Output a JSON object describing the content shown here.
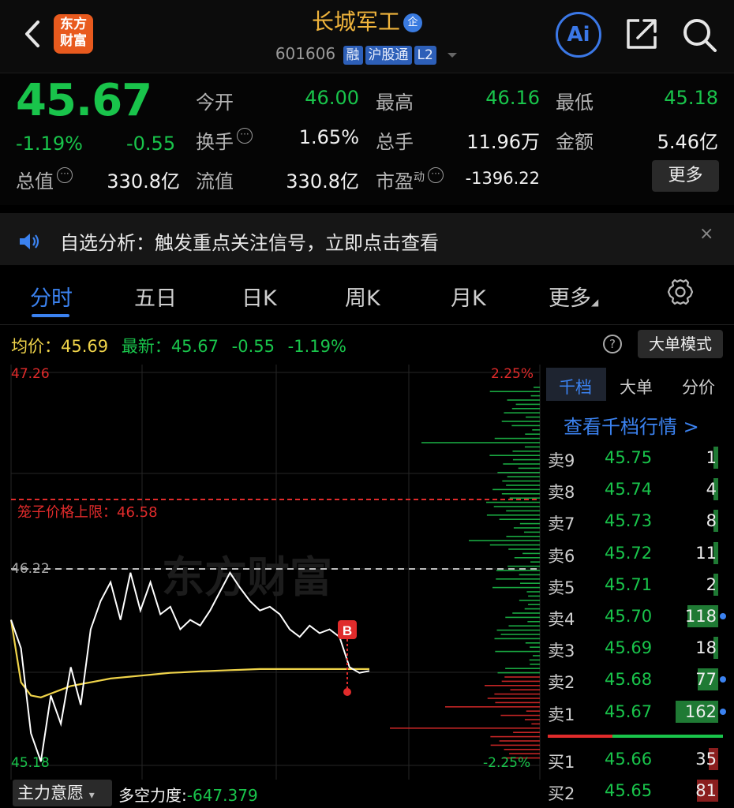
{
  "header": {
    "logo_line1": "东方",
    "logo_line2": "财富",
    "stock_name": "长城军工",
    "name_badge": "企",
    "code": "601606",
    "tags": [
      "融",
      "沪股通",
      "L2"
    ],
    "ai_label": "Ai"
  },
  "quote": {
    "price": "45.67",
    "change_pct": "-1.19%",
    "change": "-0.55",
    "open_label": "今开",
    "open": "46.00",
    "high_label": "最高",
    "high": "46.16",
    "low_label": "最低",
    "low": "45.18",
    "turnover_label": "换手",
    "turnover": "1.65%",
    "volume_label": "总手",
    "volume": "11.96万",
    "amount_label": "金额",
    "amount": "5.46亿",
    "mktcap_label": "总值",
    "mktcap": "330.8亿",
    "float_label": "流值",
    "float": "330.8亿",
    "pe_label": "市盈",
    "pe_sup": "动",
    "pe": "-1396.22",
    "more_label": "更多",
    "info_glyph": "···"
  },
  "notice": {
    "text": "自选分析：触发重点关注信号，立即点击查看",
    "close": "×"
  },
  "tabs": {
    "items": [
      "分时",
      "五日",
      "日K",
      "周K",
      "月K",
      "更多"
    ],
    "active": "分时",
    "more_caret": "◢"
  },
  "info_row": {
    "avg_label": "均价：",
    "avg": "45.69",
    "latest_label": "最新：",
    "latest": "45.67",
    "change": "-0.55",
    "change_pct": "-1.19%",
    "help": "?",
    "big_order_mode": "大单模式"
  },
  "chart": {
    "top_price": "47.26",
    "bottom_price": "45.18",
    "top_pct": "2.25%",
    "bottom_pct": "-2.25%",
    "limit_label": "笼子价格上限：46.58",
    "prev_close": "46.22",
    "watermark": "东方财富",
    "buy_marker": "B"
  },
  "chart_data": {
    "type": "line",
    "title": "",
    "ylim": [
      45.18,
      47.26
    ],
    "series": [
      {
        "name": "",
        "values": [
          45.95,
          45.8,
          45.35,
          45.2,
          45.55,
          45.4,
          45.7,
          45.5,
          45.9,
          46.05,
          46.15,
          45.95,
          46.2,
          46.0,
          46.15,
          45.98,
          46.02,
          45.9,
          45.95,
          45.92,
          46.0,
          46.1,
          46.2,
          46.12,
          46.05,
          46.0,
          46.02,
          45.98,
          45.9,
          45.86,
          45.92,
          45.88,
          45.9,
          45.86,
          45.7,
          45.67,
          45.68
        ]
      },
      {
        "name": "",
        "values": [
          45.95,
          45.62,
          45.55,
          45.54,
          45.56,
          45.58,
          45.6,
          45.61,
          45.62,
          45.63,
          45.64,
          45.645,
          45.65,
          45.655,
          45.66,
          45.665,
          45.67,
          45.672,
          45.675,
          45.678,
          45.68,
          45.682,
          45.684,
          45.686,
          45.688,
          45.69,
          45.69,
          45.69,
          45.69,
          45.69,
          45.69,
          45.69,
          45.69,
          45.69,
          45.69,
          45.69,
          45.69
        ]
      }
    ],
    "grid": true
  },
  "colors": {
    "up": "#e02b2b",
    "down": "#19c44b",
    "price_line": "#ffffff",
    "avg_line": "#f0d44a",
    "accent": "#3b82f0"
  },
  "order_book": {
    "tabs": [
      "千档",
      "大单",
      "分价"
    ],
    "active_tab": "千档",
    "link": "查看千档行情 >",
    "asks": [
      {
        "label": "卖9",
        "price": "45.75",
        "vol": "1"
      },
      {
        "label": "卖8",
        "price": "45.74",
        "vol": "4"
      },
      {
        "label": "卖7",
        "price": "45.73",
        "vol": "8"
      },
      {
        "label": "卖6",
        "price": "45.72",
        "vol": "11"
      },
      {
        "label": "卖5",
        "price": "45.71",
        "vol": "2"
      },
      {
        "label": "卖4",
        "price": "45.70",
        "vol": "118"
      },
      {
        "label": "卖3",
        "price": "45.69",
        "vol": "18"
      },
      {
        "label": "卖2",
        "price": "45.68",
        "vol": "77"
      },
      {
        "label": "卖1",
        "price": "45.67",
        "vol": "162"
      }
    ],
    "bids": [
      {
        "label": "买1",
        "price": "45.66",
        "vol": "35"
      },
      {
        "label": "买2",
        "price": "45.65",
        "vol": "81"
      }
    ]
  },
  "bottom": {
    "main_force": "主力意愿",
    "main_force_caret": "▾",
    "ls_label": "多空力度:",
    "ls_value": "-647.379"
  }
}
